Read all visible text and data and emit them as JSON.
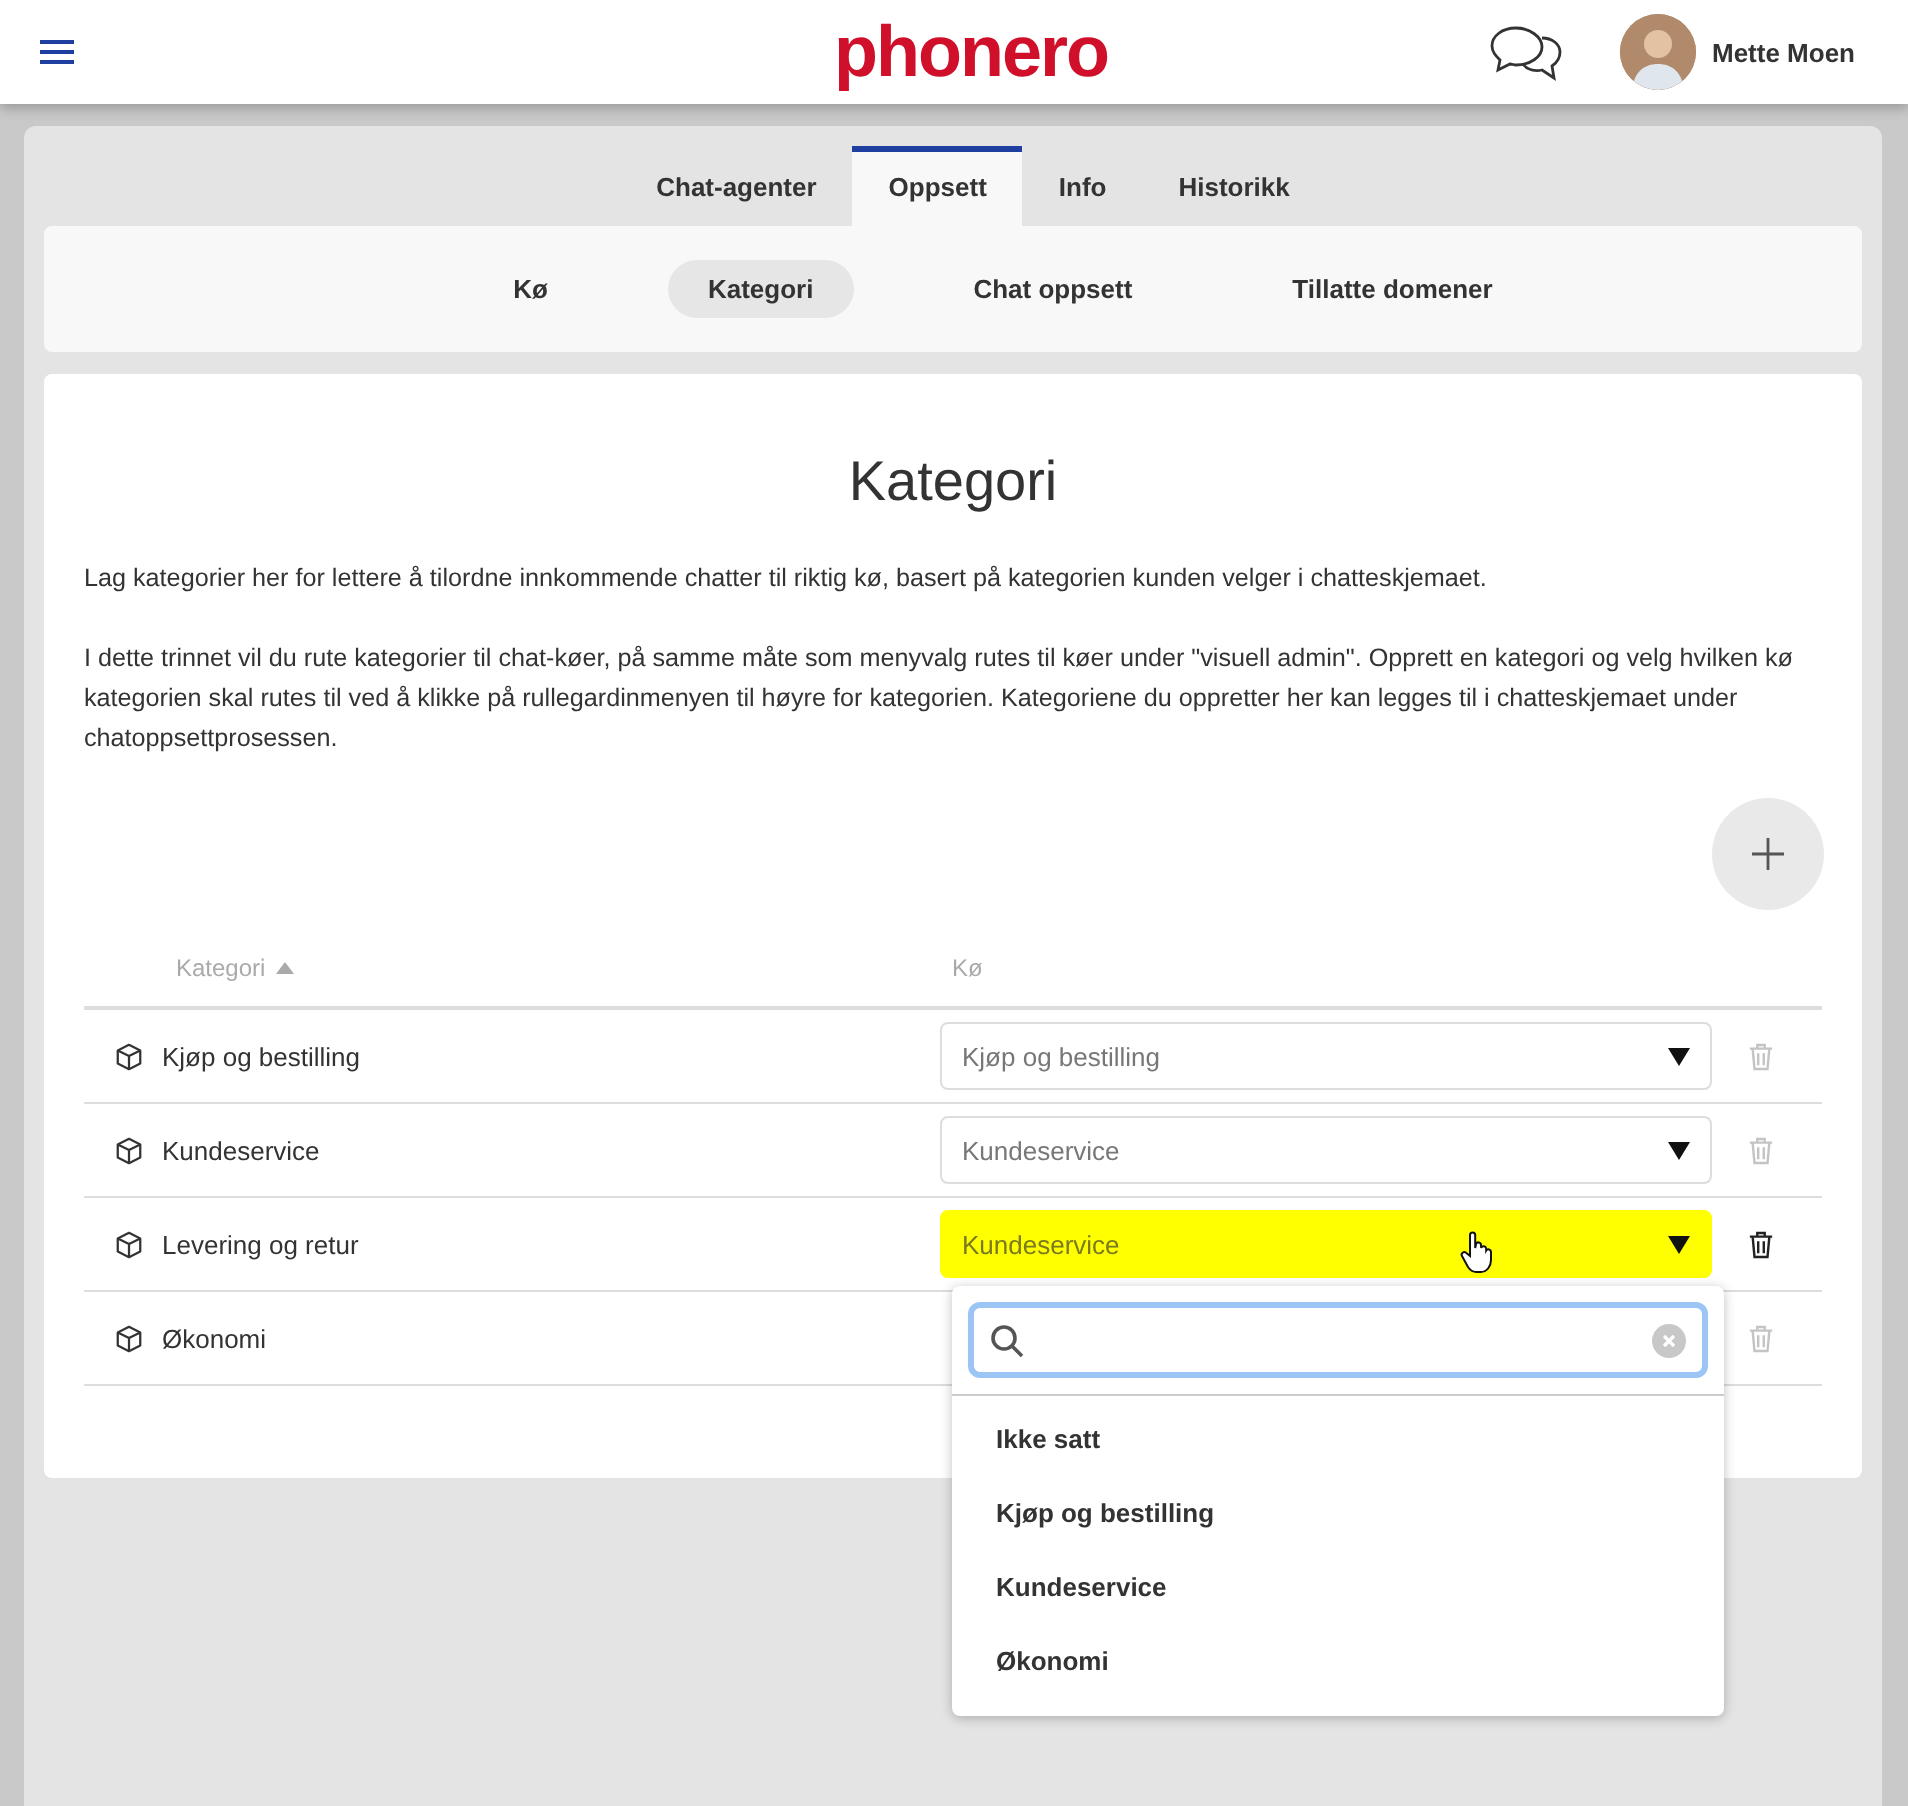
{
  "header": {
    "logo": "phonero",
    "user_name": "Mette Moen"
  },
  "tabs": [
    {
      "label": "Chat-agenter",
      "selected": false
    },
    {
      "label": "Oppsett",
      "selected": true
    },
    {
      "label": "Info",
      "selected": false
    },
    {
      "label": "Historikk",
      "selected": false
    }
  ],
  "subtabs": [
    {
      "label": "Kø",
      "selected": false
    },
    {
      "label": "Kategori",
      "selected": true
    },
    {
      "label": "Chat oppsett",
      "selected": false
    },
    {
      "label": "Tillatte domener",
      "selected": false
    }
  ],
  "page": {
    "title": "Kategori",
    "paragraphs": [
      "Lag kategorier her for lettere å tilordne innkommende chatter til riktig kø, basert på kategorien kunden velger i chatteskjemaet.",
      "I dette trinnet vil du rute kategorier til chat-køer, på samme måte som menyvalg rutes til køer under \"visuell admin\". Opprett en kategori og velg hvilken kø kategorien skal rutes til ved å klikke på rullegardinmenyen til høyre for kategorien. Kategoriene du oppretter her kan legges til i chatteskjemaet under chatoppsettprosessen."
    ]
  },
  "table": {
    "columns": [
      "Kategori",
      "Kø"
    ],
    "rows": [
      {
        "category": "Kjøp og bestilling",
        "queue": "Kjøp og bestilling",
        "active": false
      },
      {
        "category": "Kundeservice",
        "queue": "Kundeservice",
        "active": false
      },
      {
        "category": "Levering og retur",
        "queue": "Kundeservice",
        "active": true
      },
      {
        "category": "Økonomi",
        "active": false
      }
    ]
  },
  "dropdown": {
    "options": [
      "Ikke satt",
      "Kjøp og bestilling",
      "Kundeservice",
      "Økonomi"
    ]
  }
}
